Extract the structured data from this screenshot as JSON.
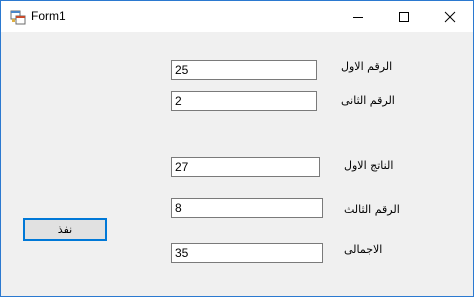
{
  "window": {
    "title": "Form1"
  },
  "fields": [
    {
      "label": "الرقم الاول",
      "value": "25"
    },
    {
      "label": "الرقم الثانى",
      "value": "2"
    },
    {
      "label": "الناتج الاول",
      "value": "27"
    },
    {
      "label": "الرقم الثالث",
      "value": "8"
    },
    {
      "label": "الاجمالى",
      "value": "35"
    }
  ],
  "execute_button": {
    "label": "نفذ"
  },
  "icons": {
    "app": "winforms-app-icon",
    "minimize": "minimize-icon",
    "maximize": "maximize-icon",
    "close": "close-icon"
  },
  "colors": {
    "accent": "#0078d7",
    "border": "#2b79d0"
  }
}
